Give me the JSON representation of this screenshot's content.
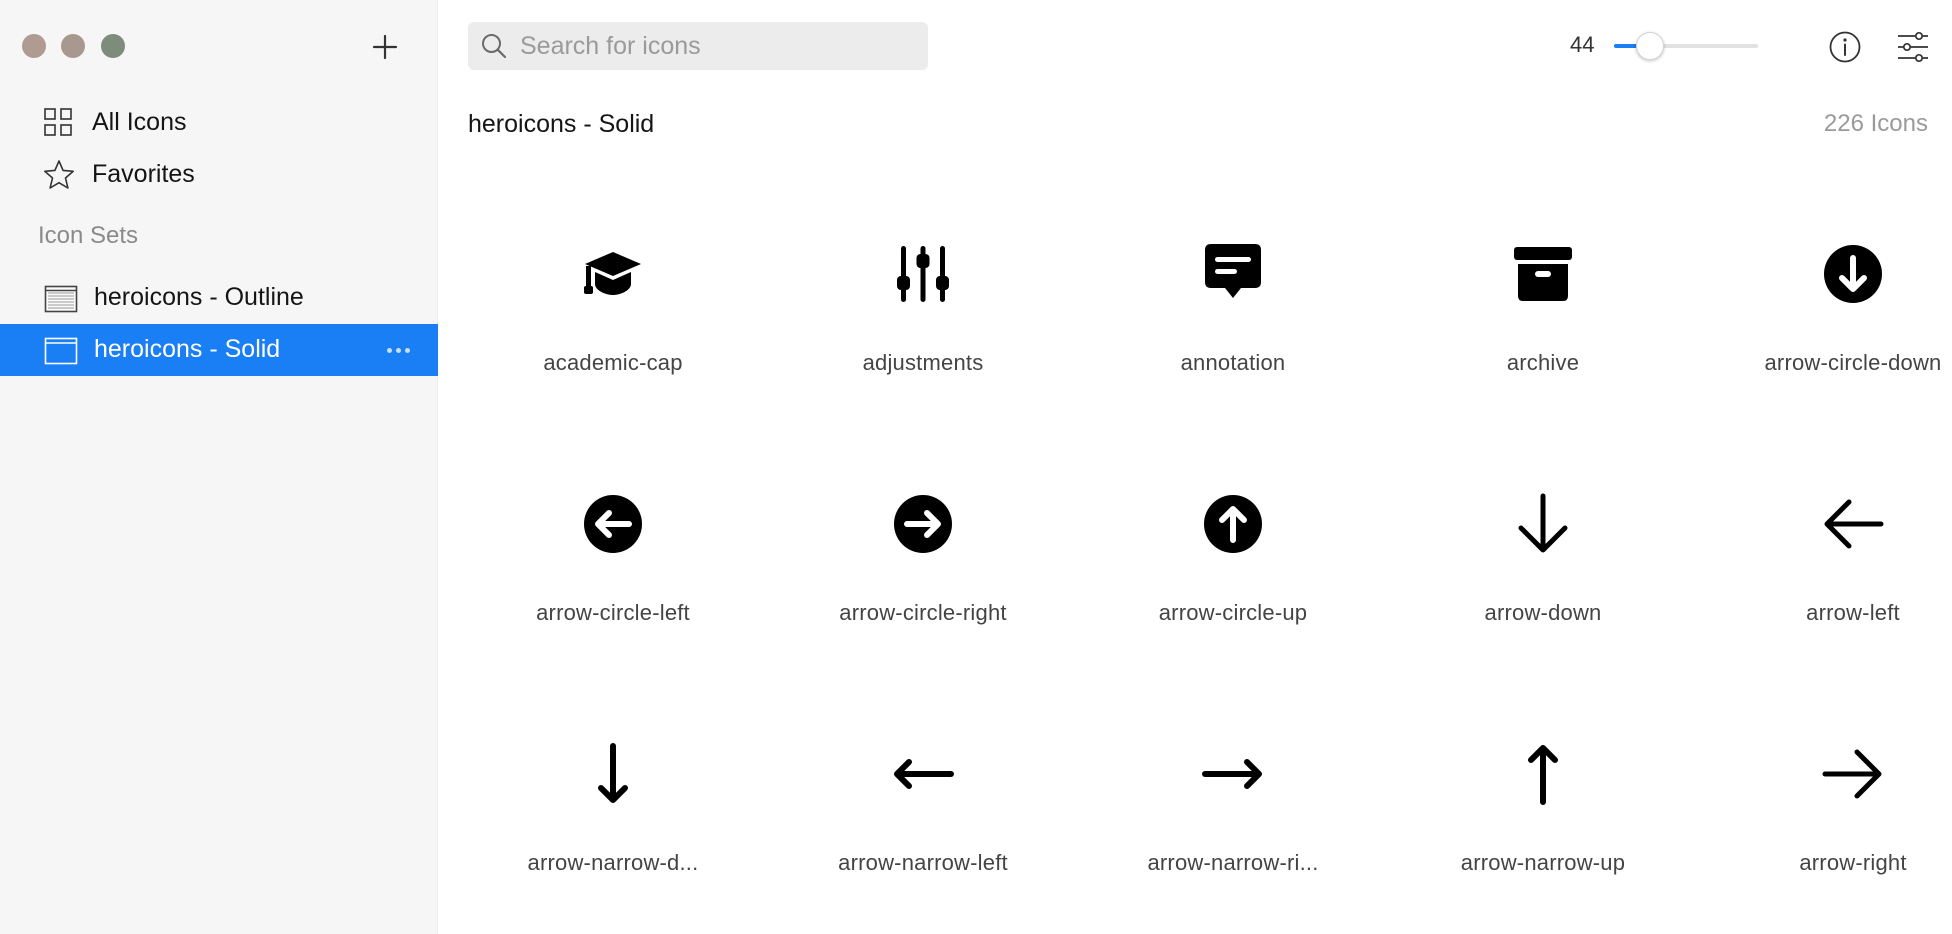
{
  "sidebar": {
    "nav": [
      {
        "label": "All Icons",
        "icon": "grid-icon"
      },
      {
        "label": "Favorites",
        "icon": "star-icon"
      }
    ],
    "section_title": "Icon Sets",
    "sets": [
      {
        "label": "heroicons - Outline",
        "selected": false
      },
      {
        "label": "heroicons - Solid",
        "selected": true
      }
    ]
  },
  "toolbar": {
    "search_placeholder": "Search for icons",
    "search_value": "",
    "zoom_value": "44",
    "zoom_fraction": 0.25
  },
  "header": {
    "title": "heroicons - Solid",
    "count": "226 Icons"
  },
  "icons": [
    {
      "label": "academic-cap",
      "icon": "academic-cap"
    },
    {
      "label": "adjustments",
      "icon": "adjustments"
    },
    {
      "label": "annotation",
      "icon": "annotation"
    },
    {
      "label": "archive",
      "icon": "archive"
    },
    {
      "label": "arrow-circle-down",
      "icon": "arrow-circle-down"
    },
    {
      "label": "arrow-circle-left",
      "icon": "arrow-circle-left"
    },
    {
      "label": "arrow-circle-right",
      "icon": "arrow-circle-right"
    },
    {
      "label": "arrow-circle-up",
      "icon": "arrow-circle-up"
    },
    {
      "label": "arrow-down",
      "icon": "arrow-down"
    },
    {
      "label": "arrow-left",
      "icon": "arrow-left"
    },
    {
      "label": "arrow-narrow-d...",
      "icon": "arrow-narrow-down"
    },
    {
      "label": "arrow-narrow-left",
      "icon": "arrow-narrow-left"
    },
    {
      "label": "arrow-narrow-ri...",
      "icon": "arrow-narrow-right"
    },
    {
      "label": "arrow-narrow-up",
      "icon": "arrow-narrow-up"
    },
    {
      "label": "arrow-right",
      "icon": "arrow-right"
    }
  ],
  "colors": {
    "accent": "#1a7ef5",
    "sidebar_bg": "#f6f6f6",
    "icon_fill": "#000000"
  }
}
